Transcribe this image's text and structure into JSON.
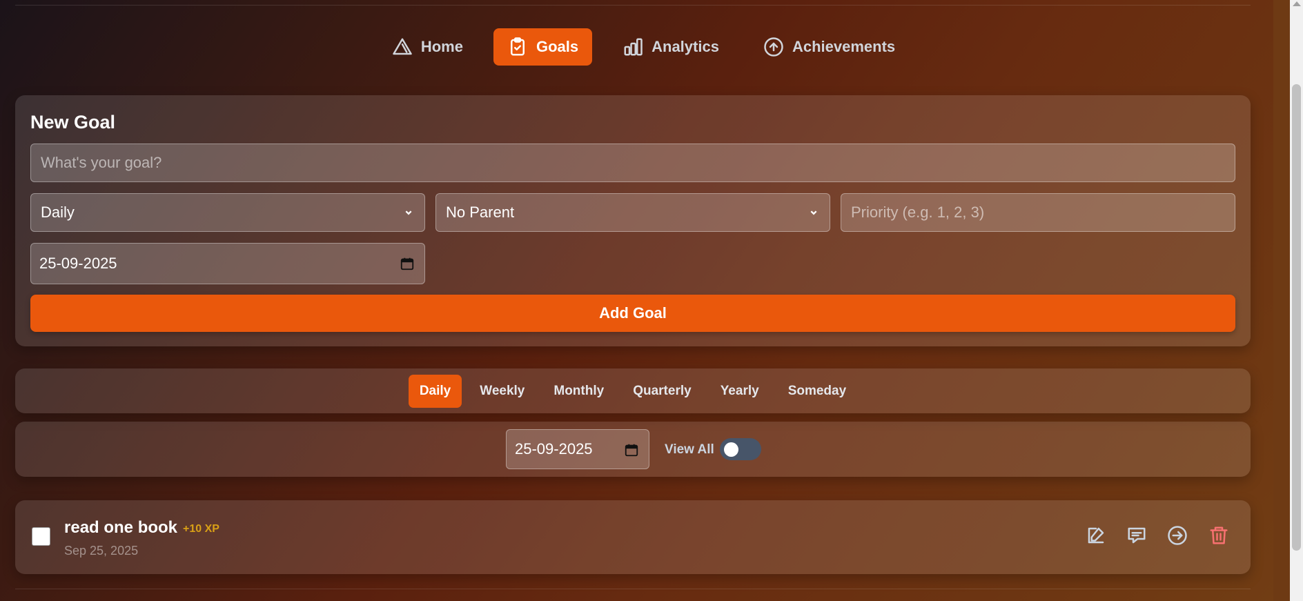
{
  "nav": {
    "items": [
      {
        "label": "Home",
        "icon": "triangle-icon"
      },
      {
        "label": "Goals",
        "icon": "clipboard-check-icon"
      },
      {
        "label": "Analytics",
        "icon": "bar-chart-icon"
      },
      {
        "label": "Achievements",
        "icon": "arrow-up-circle-icon"
      }
    ],
    "active": "Goals"
  },
  "new_goal": {
    "title": "New Goal",
    "goal_placeholder": "What's your goal?",
    "frequency_value": "Daily",
    "parent_value": "No Parent",
    "priority_placeholder": "Priority (e.g. 1, 2, 3)",
    "date_value": "25-09-2025",
    "add_label": "Add Goal"
  },
  "tabs": {
    "items": [
      "Daily",
      "Weekly",
      "Monthly",
      "Quarterly",
      "Yearly",
      "Someday"
    ],
    "active": "Daily"
  },
  "filter": {
    "date_value": "25-09-2025",
    "view_all_label": "View All",
    "view_all_on": false
  },
  "goals": [
    {
      "title": "read one book",
      "xp": "+10 XP",
      "date": "Sep 25, 2025",
      "completed": false,
      "actions": [
        "edit-icon",
        "comment-icon",
        "move-icon",
        "trash-icon"
      ]
    }
  ],
  "colors": {
    "accent": "#ea580c",
    "xp": "#d9a016",
    "delete": "#f87171",
    "toggle_off": "#475569"
  }
}
